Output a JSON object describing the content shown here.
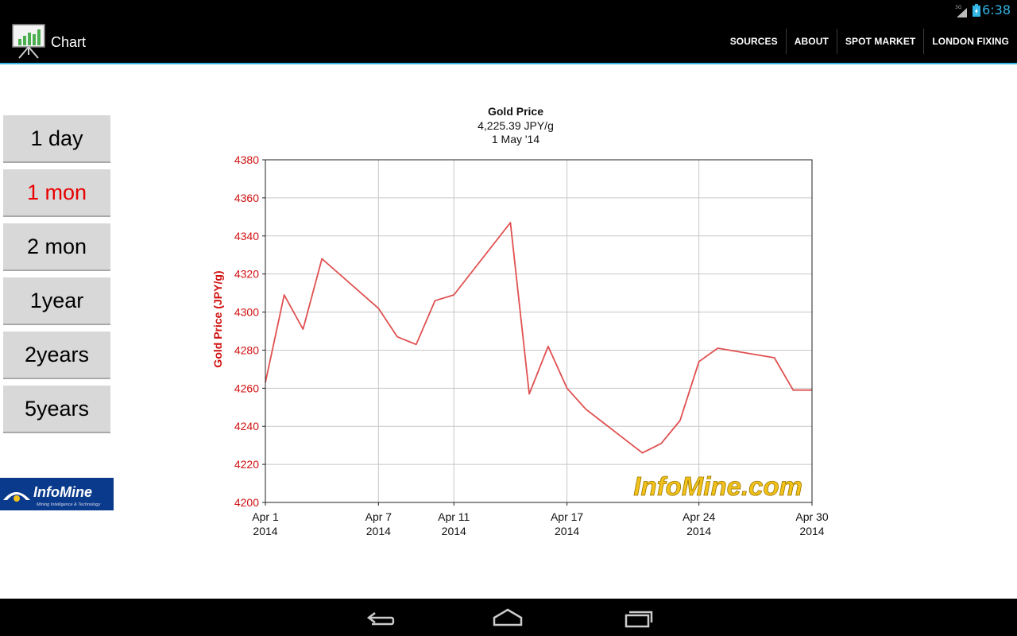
{
  "status_bar": {
    "time": "6:38",
    "network": "3G",
    "signal_icon": "cell-signal-icon",
    "battery_icon": "battery-icon",
    "accent_color": "#33b5e5"
  },
  "action_bar": {
    "title": "Chart",
    "icon": "chart-presentation-icon",
    "actions": [
      "SOURCES",
      "ABOUT",
      "SPOT MARKET",
      "LONDON FIXING"
    ]
  },
  "range_buttons": [
    {
      "label": "1 day",
      "active": false
    },
    {
      "label": "1 mon",
      "active": true
    },
    {
      "label": "2 mon",
      "active": false
    },
    {
      "label": "1year",
      "active": false
    },
    {
      "label": "2years",
      "active": false
    },
    {
      "label": "5years",
      "active": false
    }
  ],
  "logo": {
    "name": "InfoMine",
    "tagline": "Mining Intelligence & Technology"
  },
  "chart_data": {
    "type": "line",
    "title": "Gold Price",
    "subtitle": "4,225.39 JPY/g",
    "date": "1 May '14",
    "ylabel": "Gold Price (JPY/g)",
    "ylim": [
      4200,
      4380
    ],
    "yticks": [
      4200,
      4220,
      4240,
      4260,
      4280,
      4300,
      4320,
      4340,
      4360,
      4380
    ],
    "xlim": [
      "2014-04-01",
      "2014-04-30"
    ],
    "xticks": [
      {
        "date": "2014-04-01",
        "label": "Apr 1",
        "year": "2014"
      },
      {
        "date": "2014-04-07",
        "label": "Apr 7",
        "year": "2014"
      },
      {
        "date": "2014-04-11",
        "label": "Apr 11",
        "year": "2014"
      },
      {
        "date": "2014-04-17",
        "label": "Apr 17",
        "year": "2014"
      },
      {
        "date": "2014-04-24",
        "label": "Apr 24",
        "year": "2014"
      },
      {
        "date": "2014-04-30",
        "label": "Apr 30",
        "year": "2014"
      }
    ],
    "grid": true,
    "line_color": "#e05050",
    "axis_label_color": "#d01010",
    "watermark": "InfoMine.com",
    "watermark_color": "#f0c21a",
    "series": [
      {
        "x": [
          "2014-04-01",
          "2014-04-02",
          "2014-04-03",
          "2014-04-04",
          "2014-04-07",
          "2014-04-08",
          "2014-04-09",
          "2014-04-10",
          "2014-04-11",
          "2014-04-14",
          "2014-04-15",
          "2014-04-16",
          "2014-04-17",
          "2014-04-18",
          "2014-04-21",
          "2014-04-22",
          "2014-04-23",
          "2014-04-24",
          "2014-04-25",
          "2014-04-28",
          "2014-04-29",
          "2014-04-30"
        ],
        "y": [
          4263,
          4309,
          4291,
          4328,
          4302,
          4287,
          4283,
          4306,
          4309,
          4347,
          4257,
          4282,
          4260,
          4249,
          4226,
          4231,
          4243,
          4274,
          4281,
          4276,
          4259,
          4259
        ]
      }
    ]
  }
}
